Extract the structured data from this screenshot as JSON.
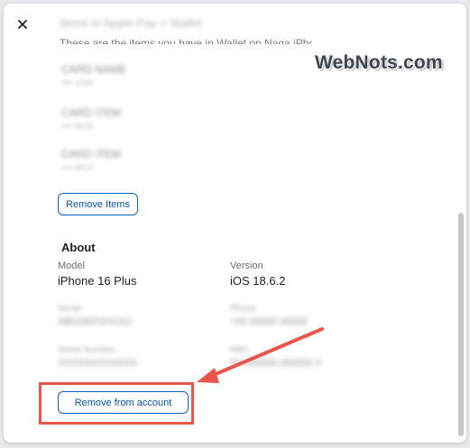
{
  "wallet": {
    "title_blurred": "Items in Apple Pay + Wallet",
    "description": "These are the items you have in Wallet on Naga iPhone.",
    "items": [
      {
        "name": "CARD NAME",
        "detail": "•••• 1234"
      },
      {
        "name": "CARD ITEM",
        "detail": "•••• 5678"
      },
      {
        "name": "CARD ITEM",
        "detail": "•••• 9012"
      }
    ],
    "remove_items_label": "Remove Items"
  },
  "watermark": "WebNots.com",
  "about": {
    "heading": "About",
    "model_label": "Model",
    "model_value": "iPhone 16 Plus",
    "version_label": "Version",
    "version_value": "iOS 18.6.2",
    "hidden_fields": [
      {
        "label": "Serial",
        "value": "ABCDEFGHIJ12"
      },
      {
        "label": "Phone",
        "value": "+00 00000 00000"
      },
      {
        "label": "Serial Number",
        "value": "XXXXXXXXXXXX"
      },
      {
        "label": "IMEI",
        "value": "00 000000 000000 0"
      }
    ]
  },
  "remove_account_label": "Remove from account",
  "colors": {
    "accent": "#0a66c2",
    "annotation": "#e8564a"
  },
  "icons": {
    "close": "close-icon"
  }
}
